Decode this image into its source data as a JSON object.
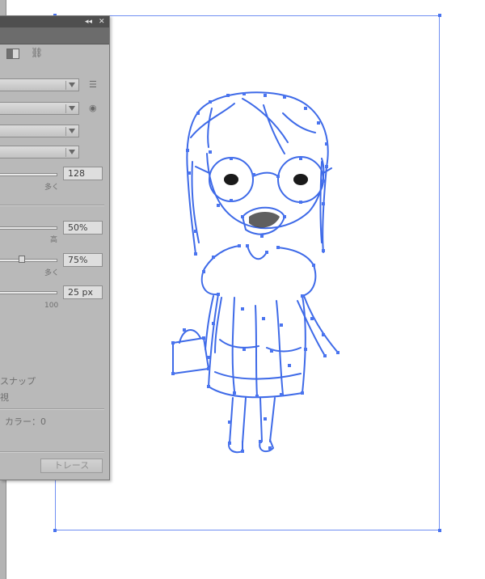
{
  "panel": {
    "collapse_icon": "double-chevron-left",
    "close_icon": "close",
    "preset_icon": "split-view-icon",
    "link_icon": "link-icon",
    "list_icon": "list-icon",
    "eye_icon": "eye-icon",
    "threshold_value": "128",
    "threshold_caption": "多く",
    "paths_value": "50%",
    "paths_caption": "高",
    "paths_level": 0.95,
    "corners_value": "75%",
    "corners_caption": "多く",
    "corners_level": 0.38,
    "noise_value": "25 px",
    "noise_caption": "100",
    "noise_level": 0.92,
    "snap_label": "スナップ",
    "view_label": "視",
    "color_label": "カラー：0",
    "trace_button": "トレース"
  },
  "colors": {
    "panel_bg": "#b9b9b9",
    "titlebar": "#4f4f4f",
    "path_blue": "#4a74ef",
    "artboard_border": "#6f8ef2"
  }
}
